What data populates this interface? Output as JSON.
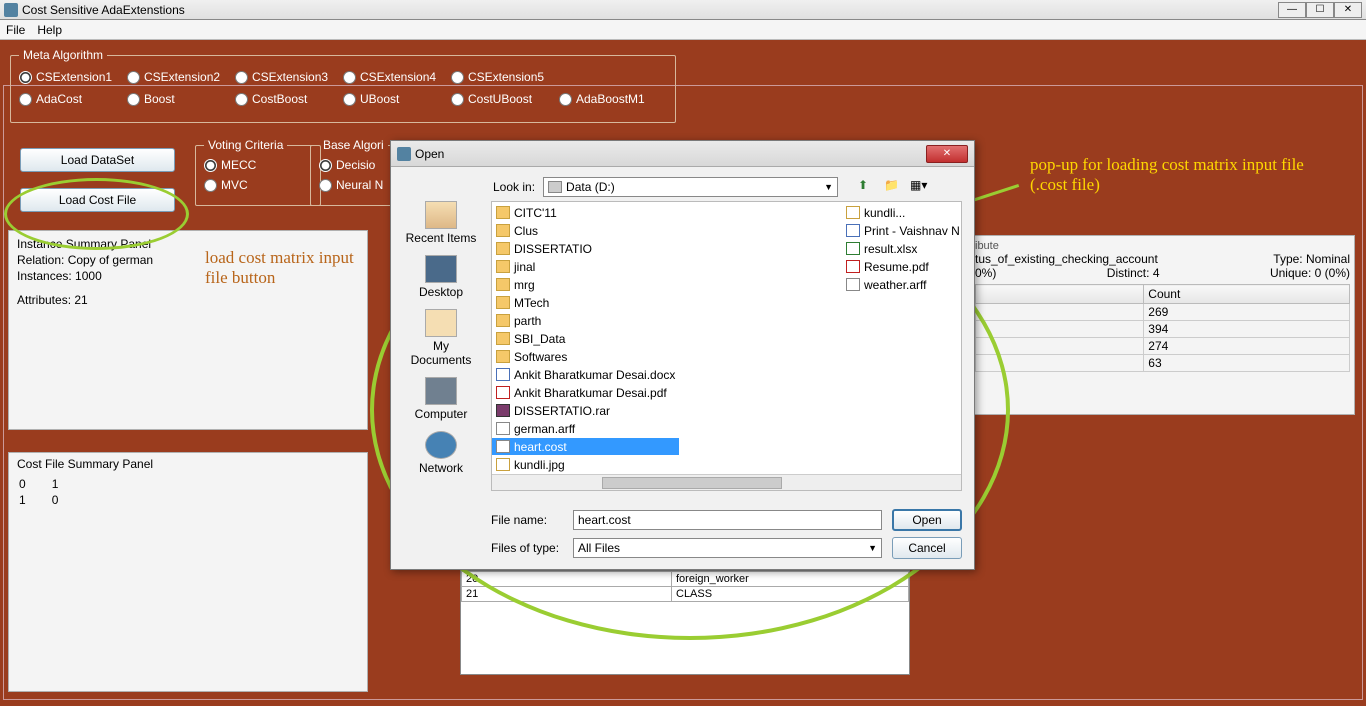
{
  "window": {
    "title": "Cost Sensitive AdaExtenstions"
  },
  "menu": {
    "file": "File",
    "help": "Help"
  },
  "meta": {
    "legend": "Meta Algorithm",
    "row1": [
      "CSExtension1",
      "CSExtension2",
      "CSExtension3",
      "CSExtension4",
      "CSExtension5"
    ],
    "row2": [
      "AdaCost",
      "Boost",
      "CostBoost",
      "UBoost",
      "CostUBoost",
      "AdaBoostM1"
    ],
    "selected": "CSExtension1"
  },
  "buttons": {
    "load_dataset": "Load DataSet",
    "load_cost": "Load Cost File"
  },
  "voting": {
    "legend": "Voting Criteria",
    "mecc": "MECC",
    "mvc": "MVC",
    "selected": "MECC"
  },
  "basealg": {
    "legend": "Base Algori",
    "decision": "Decisio",
    "neural": "Neural N",
    "selected": "Decisio"
  },
  "instance": {
    "title": "Instance Summary Panel",
    "relation_label": "Relation:",
    "relation": "Copy of german",
    "instances_label": "Instances:",
    "instances": "1000",
    "attributes_label": "Attributes:",
    "attributes": "21"
  },
  "costfile": {
    "title": "Cost File Summary Panel",
    "rows": [
      [
        "0",
        "1"
      ],
      [
        "1",
        "0"
      ]
    ]
  },
  "attr_table": {
    "rows": [
      [
        "20",
        "foreign_worker"
      ],
      [
        "21",
        "CLASS"
      ]
    ]
  },
  "right": {
    "attr_partial": "tus_of_existing_checking_account",
    "pct_partial": "0%)",
    "type_label": "Type:",
    "type": "Nominal",
    "distinct_label": "Distinct:",
    "distinct": "4",
    "unique_label": "Unique:",
    "unique": "0 (0%)",
    "count_hdr": "Count",
    "counts": [
      "269",
      "394",
      "274",
      "63"
    ]
  },
  "annotations": {
    "load_cost_text": "load cost matrix input file button",
    "popup_text": "pop-up for loading cost matrix input file (.cost file)"
  },
  "dialog": {
    "title": "Open",
    "lookin_label": "Look in:",
    "lookin_value": "Data (D:)",
    "places": {
      "recent": "Recent Items",
      "desktop": "Desktop",
      "mydocs": "My Documents",
      "computer": "Computer",
      "network": "Network"
    },
    "files_col1": [
      {
        "name": "CITC'11",
        "type": "folder"
      },
      {
        "name": "Clus",
        "type": "folder"
      },
      {
        "name": "DISSERTATIO",
        "type": "folder"
      },
      {
        "name": "jinal",
        "type": "folder"
      },
      {
        "name": "mrg",
        "type": "folder"
      },
      {
        "name": "MTech",
        "type": "folder"
      },
      {
        "name": "parth",
        "type": "folder"
      },
      {
        "name": "SBI_Data",
        "type": "folder"
      },
      {
        "name": "Softwares",
        "type": "folder"
      },
      {
        "name": "Ankit Bharatkumar Desai.docx",
        "type": "doc"
      },
      {
        "name": "Ankit Bharatkumar Desai.pdf",
        "type": "pdf"
      },
      {
        "name": "DISSERTATIO.rar",
        "type": "rar"
      },
      {
        "name": "german.arff",
        "type": "file"
      },
      {
        "name": "heart.cost",
        "type": "file",
        "selected": true
      },
      {
        "name": "kundli.jpg",
        "type": "img"
      }
    ],
    "files_col2": [
      {
        "name": "kundli...",
        "type": "img"
      },
      {
        "name": "Print - Vaishnav N",
        "type": "doc"
      },
      {
        "name": "result.xlsx",
        "type": "xls"
      },
      {
        "name": "Resume.pdf",
        "type": "pdf"
      },
      {
        "name": "weather.arff",
        "type": "file"
      }
    ],
    "filename_label": "File name:",
    "filename": "heart.cost",
    "filetype_label": "Files of type:",
    "filetype": "All Files",
    "open": "Open",
    "cancel": "Cancel"
  }
}
